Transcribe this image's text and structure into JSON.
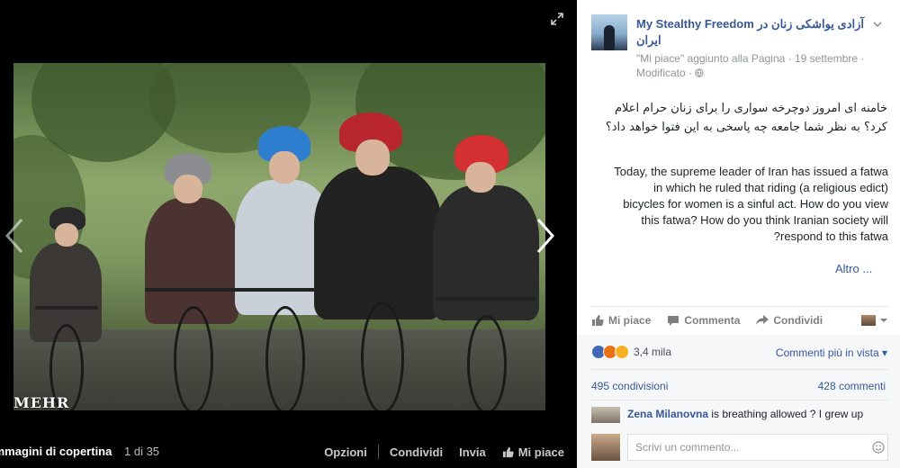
{
  "viewer": {
    "watermark": "MEHR",
    "album_title": "Immagini di copertina",
    "counter": "1 di 35",
    "actions": {
      "options": "Opzioni",
      "share": "Condividi",
      "send": "Invia",
      "like": "Mi piace"
    }
  },
  "post": {
    "page_name": "My Stealthy Freedom آزادی یواشکی زنان در ایران",
    "meta_line1": "\"Mi piace\" aggiunto alla Pagina · 19 settembre ·",
    "meta_line2": "Modificato ·",
    "text_fa": "خامنه ای امروز دوچرخه سواری را برای زنان حرام اعلام کرد؟ به نظر شما جامعه چه پاسخی به این فتوا خواهد داد؟",
    "text_en_lines": [
      "Today, the supreme leader of Iran has issued a fatwa",
      "(a religious edict) in which he ruled that riding",
      "bicycles for women is a sinful act. How do you view",
      "this fatwa? How do you think Iranian society will",
      "respond to this fatwa?"
    ],
    "more": "Altro ..."
  },
  "actions": {
    "like": "Mi piace",
    "comment": "Commenta",
    "share": "Condividi"
  },
  "stats": {
    "reactions_count": "3,4 mila",
    "sort": "Commenti più in vista",
    "shares": "495 condivisioni",
    "comments": "428 commenti"
  },
  "comment": {
    "author": "Zena Milanovna",
    "text": "is breathing allowed ? I grew up"
  },
  "composer": {
    "placeholder": "Scrivi un commento..."
  },
  "colors": {
    "link": "#365899",
    "like_blue": "#4267b2",
    "panel_bg": "#ffffff",
    "viewer_bg": "#000000"
  },
  "icons": [
    "expand-icon",
    "chevron-left-icon",
    "chevron-right-icon",
    "thumbs-up-icon",
    "comment-icon",
    "share-icon",
    "globe-icon",
    "chevron-down-icon",
    "emoji-icon"
  ]
}
